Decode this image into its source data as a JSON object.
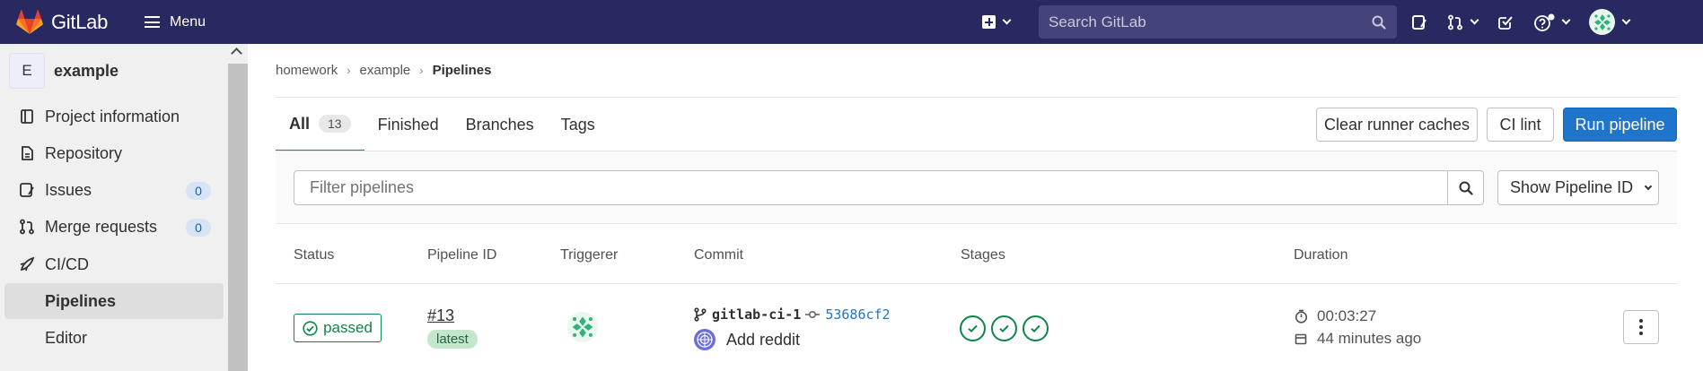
{
  "header": {
    "logo_text": "GitLab",
    "menu_label": "Menu",
    "search_placeholder": "Search GitLab",
    "brand_color": "#292961"
  },
  "sidebar": {
    "project_initial": "E",
    "project_name": "example",
    "items": [
      {
        "label": "Project information",
        "icon": "info-icon"
      },
      {
        "label": "Repository",
        "icon": "document-icon"
      },
      {
        "label": "Issues",
        "icon": "issues-icon",
        "count": "0"
      },
      {
        "label": "Merge requests",
        "icon": "merge-request-icon",
        "count": "0"
      },
      {
        "label": "CI/CD",
        "icon": "rocket-icon"
      },
      {
        "label": "Pipelines"
      },
      {
        "label": "Editor"
      }
    ]
  },
  "breadcrumb": [
    "homework",
    "example",
    "Pipelines"
  ],
  "tabs": [
    {
      "label": "All",
      "count": "13"
    },
    {
      "label": "Finished"
    },
    {
      "label": "Branches"
    },
    {
      "label": "Tags"
    }
  ],
  "actions": {
    "clear_caches": "Clear runner caches",
    "ci_lint": "CI lint",
    "run_pipeline": "Run pipeline"
  },
  "filter": {
    "placeholder": "Filter pipelines",
    "id_select": "Show Pipeline ID"
  },
  "table": {
    "headers": [
      "Status",
      "Pipeline ID",
      "Triggerer",
      "Commit",
      "Stages",
      "Duration"
    ],
    "rows": [
      {
        "status": "passed",
        "pipeline_id": "#13",
        "tag": "latest",
        "branch": "gitlab-ci-1",
        "sha": "53686cf2",
        "message": "Add reddit",
        "stages": [
          "passed",
          "passed",
          "passed"
        ],
        "duration": "00:03:27",
        "finished": "44 minutes ago"
      }
    ]
  },
  "colors": {
    "accent": "#1f75cb",
    "success": "#108548"
  }
}
